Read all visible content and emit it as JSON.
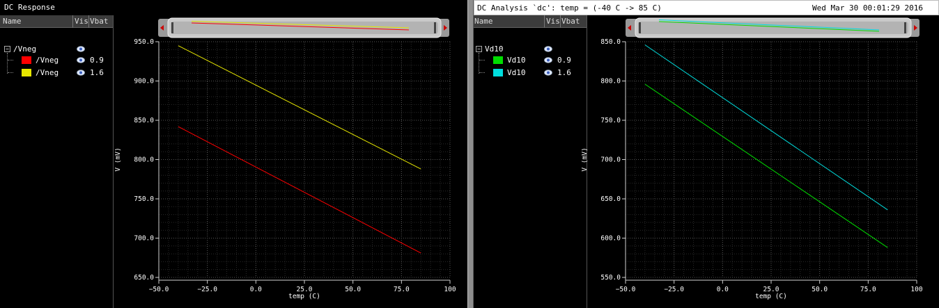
{
  "left_panel": {
    "title": "DC Response",
    "legend_headers": {
      "name": "Name",
      "vis": "Vis",
      "param": "Vbat"
    },
    "group_label": "/Vneg",
    "group_toggle": "−",
    "rows": [
      {
        "name": "/Vneg",
        "value": "0.9",
        "color": "#ff0000"
      },
      {
        "name": "/Vneg",
        "value": "1.6",
        "color": "#e6e600"
      }
    ]
  },
  "right_panel": {
    "title": "DC Analysis `dc': temp = (-40 C -> 85 C)",
    "timestamp": "Wed Mar 30 00:01:29 2016",
    "legend_headers": {
      "name": "Name",
      "vis": "Vis",
      "param": "Vbat"
    },
    "group_label": "Vd10",
    "group_toggle": "−",
    "rows": [
      {
        "name": "Vd10",
        "value": "0.9",
        "color": "#00dd00"
      },
      {
        "name": "Vd10",
        "value": "1.6",
        "color": "#00dddd"
      }
    ]
  },
  "chart_data": [
    {
      "type": "line",
      "title": "",
      "xlabel": "temp (C)",
      "ylabel": "V (mV)",
      "xlim": [
        -50,
        100
      ],
      "ylim": [
        650,
        950
      ],
      "xticks": [
        -50,
        -25,
        0,
        25,
        50,
        75,
        100
      ],
      "xtick_labels": [
        "−50.0",
        "−25.0",
        "0.0",
        "25.0",
        "50.0",
        "75.0",
        "100"
      ],
      "yticks": [
        650,
        700,
        750,
        800,
        850,
        900,
        950
      ],
      "ytick_labels": [
        "650.0",
        "700.0",
        "750.0",
        "800.0",
        "850.0",
        "900.0",
        "950.0"
      ],
      "grid": true,
      "series": [
        {
          "name": "/Vneg 0.9",
          "color": "#ff0000",
          "x": [
            -40,
            85
          ],
          "y": [
            842,
            681
          ]
        },
        {
          "name": "/Vneg 1.6",
          "color": "#e6e600",
          "x": [
            -40,
            85
          ],
          "y": [
            945,
            788
          ]
        }
      ]
    },
    {
      "type": "line",
      "title": "",
      "xlabel": "temp (C)",
      "ylabel": "V (mV)",
      "xlim": [
        -50,
        100
      ],
      "ylim": [
        550,
        850
      ],
      "xticks": [
        -50,
        -25,
        0,
        25,
        50,
        75,
        100
      ],
      "xtick_labels": [
        "−50.0",
        "−25.0",
        "0.0",
        "25.0",
        "50.0",
        "75.0",
        "100"
      ],
      "yticks": [
        550,
        600,
        650,
        700,
        750,
        800,
        850
      ],
      "ytick_labels": [
        "550.0",
        "600.0",
        "650.0",
        "700.0",
        "750.0",
        "800.0",
        "850.0"
      ],
      "grid": true,
      "series": [
        {
          "name": "Vd10 0.9",
          "color": "#00dd00",
          "x": [
            -40,
            85
          ],
          "y": [
            796,
            588
          ]
        },
        {
          "name": "Vd10 1.6",
          "color": "#00dddd",
          "x": [
            -40,
            85
          ],
          "y": [
            846,
            636
          ]
        }
      ]
    }
  ]
}
